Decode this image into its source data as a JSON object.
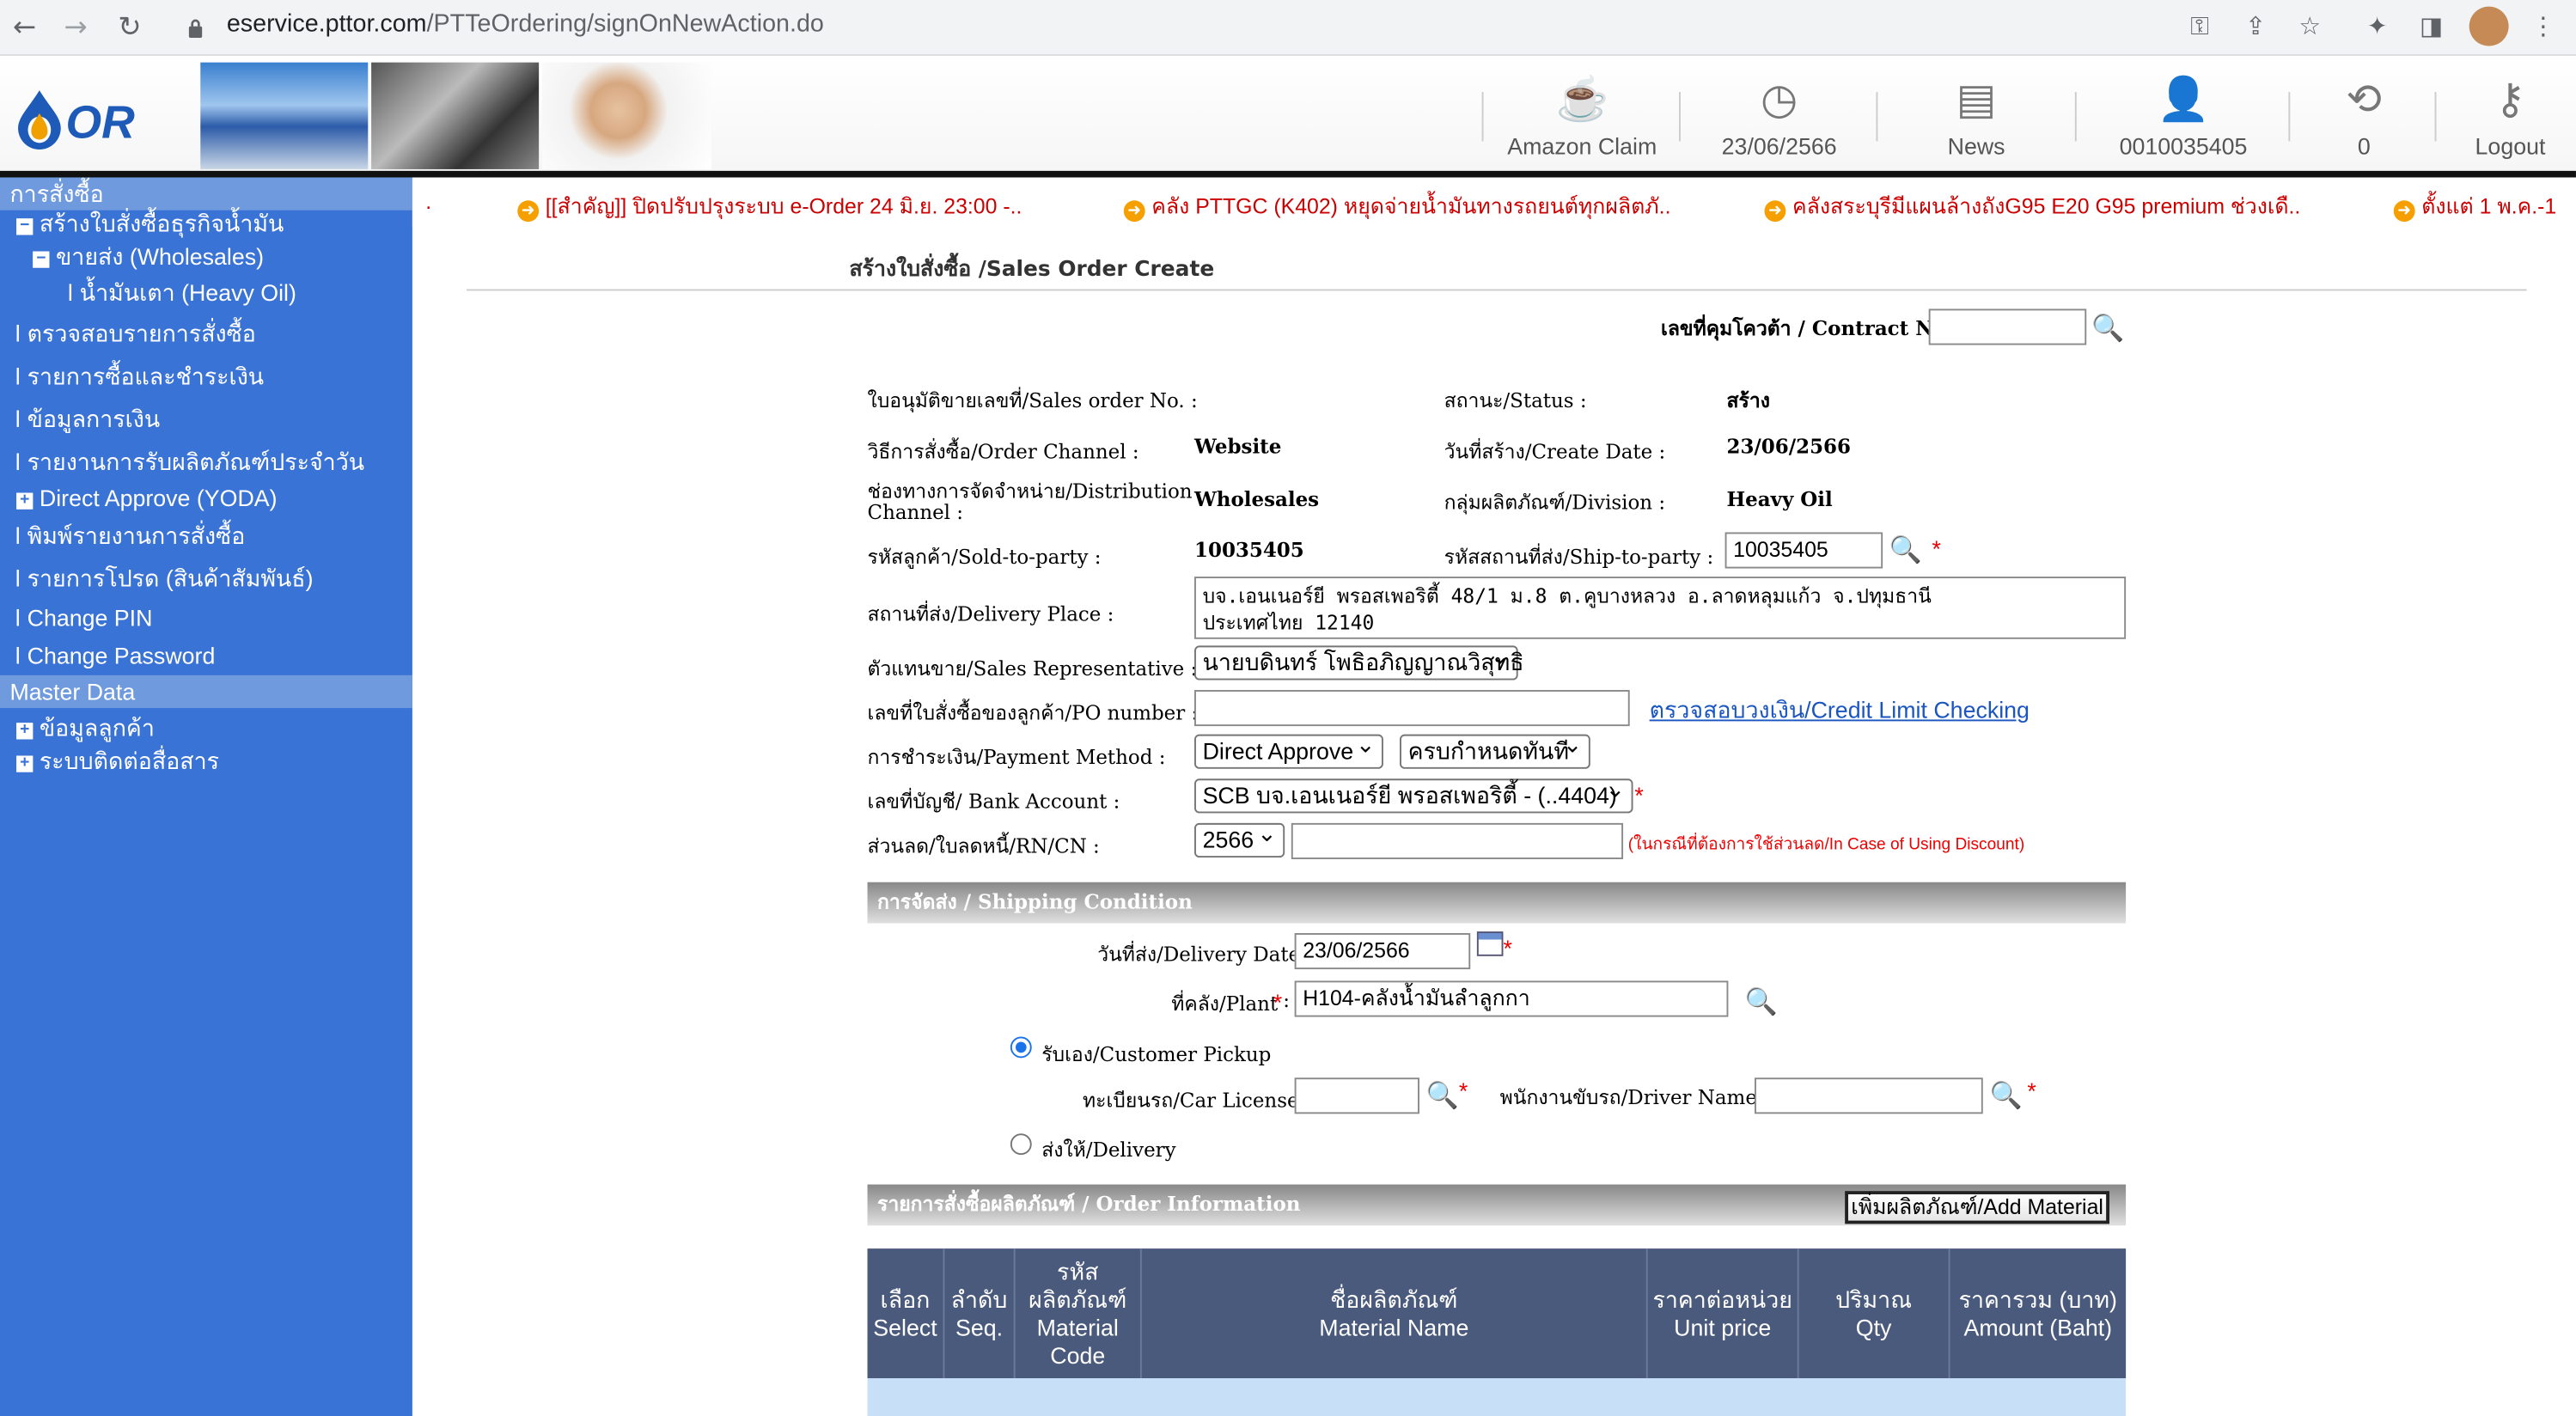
{
  "browser": {
    "url_host": "eservice.pttor.com",
    "url_path": "/PTTeOrdering/signOnNewAction.do"
  },
  "header": {
    "logo_text": "OR",
    "items": [
      {
        "label": "Amazon Claim",
        "icon": "amazon-cafe-icon"
      },
      {
        "label": "23/06/2566",
        "icon": "clock-icon"
      },
      {
        "label": "News",
        "icon": "news-icon"
      },
      {
        "label": "0010035405",
        "icon": "user-icon"
      },
      {
        "label": "0",
        "icon": "refresh-icon"
      },
      {
        "label": "Logout",
        "icon": "keys-icon"
      }
    ]
  },
  "sidebar": {
    "section1": "การสั่งซื้อ",
    "items": [
      "สร้างใบสั่งซื้อธุรกิจน้ำมัน",
      "ขายส่ง (Wholesales)",
      "น้ำมันเตา (Heavy Oil)",
      "ตรวจสอบรายการสั่งซื้อ",
      "รายการซื้อและชำระเงิน",
      "ข้อมูลการเงิน",
      "รายงานการรับผลิตภัณฑ์ประจำวัน",
      "Direct Approve (YODA)",
      "พิมพ์รายงานการสั่งซื้อ",
      "รายการโปรด (สินค้าสัมพันธ์)",
      "Change PIN",
      "Change Password"
    ],
    "section2": "Master Data",
    "master_items": [
      "ข้อมูลลูกค้า",
      "ระบบติดต่อสื่อสาร"
    ]
  },
  "ticker": {
    "lead": ".",
    "items": [
      "[[สำคัญ]] ปิดปรับปรุงระบบ e-Order 24 มิ.ย. 23:00 -..",
      "คลัง PTTGC (K402) หยุดจ่ายน้ำมันทางรถยนต์ทุกผลิตภั..",
      "คลังสระบุรีมีแผนล้างถังG95 E20 G95 premium ช่วงเดื..",
      "ตั้งแต่ 1 พ.ค.-1"
    ]
  },
  "form": {
    "page_title": "สร้างใบสั่งซื้อ /Sales Order Create",
    "contract_label": "เลขที่คุมโควต้า / Contract No :",
    "contract_value": "",
    "sales_order_label": "ใบอนุมัติขายเลขที่/Sales order No. :",
    "status_label": "สถานะ/Status :",
    "status_value": "สร้าง",
    "order_channel_label": "วิธีการสั่งซื้อ/Order Channel :",
    "order_channel_value": "Website",
    "create_date_label": "วันที่สร้าง/Create Date :",
    "create_date_value": "23/06/2566",
    "dist_channel_label_1": "ช่องทางการจัดจำหน่าย/Distribution",
    "dist_channel_label_2": "Channel :",
    "dist_channel_value": "Wholesales",
    "division_label": "กลุ่มผลิตภัณฑ์/Division :",
    "division_value": "Heavy Oil",
    "sold_to_label": "รหัสลูกค้า/Sold-to-party :",
    "sold_to_value": "10035405",
    "ship_to_label": "รหัสสถานที่ส่ง/Ship-to-party :",
    "ship_to_value": "10035405",
    "delivery_place_label": "สถานที่ส่ง/Delivery Place :",
    "delivery_place_line1": "บจ.เอนเนอร์ยี พรอสเพอริตี้ 48/1 ม.8  ต.คูบางหลวง อ.ลาดหลุมแก้ว จ.ปทุมธานี",
    "delivery_place_line2": "ประเทศไทย 12140",
    "sales_rep_label": "ตัวแทนขาย/Sales Representative :",
    "sales_rep_value": "นายบดินทร์ โพธิอภิญญาณวิสุทธิ",
    "po_label": "เลขที่ใบสั่งซื้อของลูกค้า/PO number :",
    "po_value": "",
    "credit_link": "ตรวจสอบวงเงิน/Credit Limit Checking",
    "payment_label": "การชำระเงิน/Payment Method :",
    "payment_value": "Direct Approve",
    "payment_term_value": "ครบกำหนดทันที",
    "bank_label": "เลขที่บัญชี/ Bank Account :",
    "bank_value": "SCB บจ.เอนเนอร์ยี พรอสเพอริตี้ - (..4404)",
    "rn_label": "ส่วนลด/ใบลดหนี้/RN/CN :",
    "rn_year": "2566",
    "rn_value": "",
    "rn_note": "(ในกรณีที่ต้องการใช้ส่วนลด/In Case of Using Discount)"
  },
  "shipping": {
    "section_title": "การจัดส่ง  /  Shipping Condition",
    "delivery_date_label": "วันที่ส่ง/Delivery Date :",
    "delivery_date_value": "23/06/2566",
    "plant_label": "ที่คลัง/Plant",
    "plant_value": "H104-คลังน้ำมันลำลูกกา",
    "pickup_label": "รับเอง/Customer Pickup",
    "car_label": "ทะเบียนรถ/Car License :",
    "car_value": "",
    "driver_label": "พนักงานขับรถ/Driver Name :",
    "driver_value": "",
    "delivery_label": "ส่งให้/Delivery"
  },
  "order": {
    "section_title": "รายการสั่งซื้อผลิตภัณฑ์  /  Order Information",
    "add_button": "เพิ่มผลิตภัณฑ์/Add Material",
    "columns": [
      {
        "th": "เลือก",
        "en": "Select"
      },
      {
        "th": "ลำดับ",
        "en": "Seq."
      },
      {
        "th": "รหัส ผลิตภัณฑ์",
        "en": "Material Code"
      },
      {
        "th": "ชื่อผลิตภัณฑ์",
        "en": "Material Name"
      },
      {
        "th": "ราคาต่อหน่วย",
        "en": "Unit price"
      },
      {
        "th": "ปริมาณ",
        "en": "Qty"
      },
      {
        "th": "ราคารวม (บาท)",
        "en": "Amount (Baht)"
      }
    ]
  }
}
